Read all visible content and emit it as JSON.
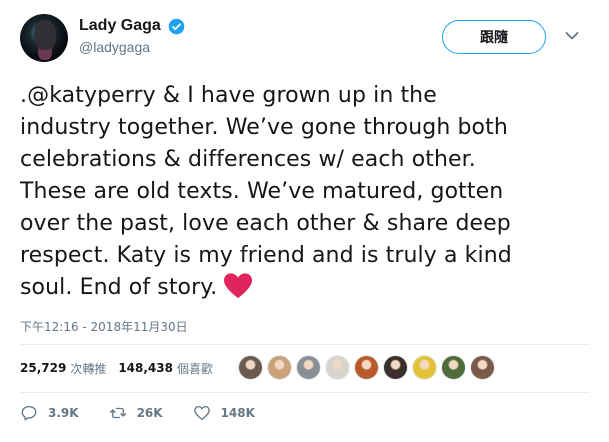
{
  "author": {
    "display_name": "Lady Gaga",
    "handle": "@ladygaga",
    "verified": true
  },
  "header": {
    "follow_label": "跟隨"
  },
  "tweet": {
    "lines": [
      ".@katyperry & I have grown up in the",
      "industry together. We’ve gone through both",
      "celebrations & differences w/ each other.",
      "These are old texts. We’ve matured, gotten",
      "over the past, love each other & share deep",
      "respect. Katy is my friend and is truly a kind",
      "soul. End of story."
    ],
    "emoji": "heart-emoji",
    "timestamp": "下午12:16 - 2018年11月30日"
  },
  "stats": {
    "retweets_count": "25,729",
    "retweets_label": "次轉推",
    "likes_count": "148,438",
    "likes_label": "個喜歡"
  },
  "likers": [
    {
      "color": "#6b5b4f"
    },
    {
      "color": "#c9a27a"
    },
    {
      "color": "#8a8f96"
    },
    {
      "color": "#d9d4cc"
    },
    {
      "color": "#b85a2b"
    },
    {
      "color": "#3a2f2a"
    },
    {
      "color": "#e3c23a"
    },
    {
      "color": "#4f6b3a"
    },
    {
      "color": "#7a5a48"
    }
  ],
  "actions": {
    "reply_count": "3.9K",
    "retweet_count": "26K",
    "like_count": "148K"
  },
  "colors": {
    "brand_blue": "#1da1f2",
    "secondary_text": "#657786",
    "heart_red": "#e0245e"
  }
}
